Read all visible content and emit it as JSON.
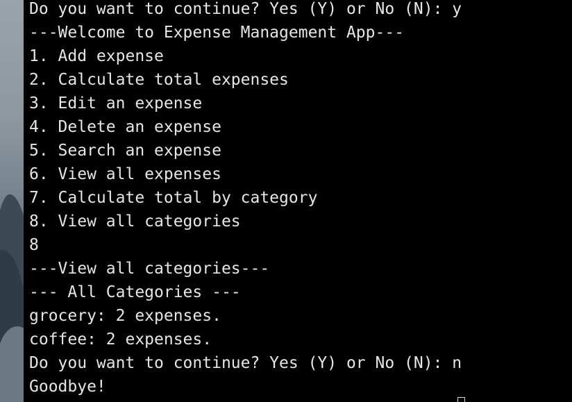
{
  "terminal": {
    "lines": [
      "Do you want to continue? Yes (Y) or No (N): y",
      "---Welcome to Expense Management App---",
      "1. Add expense",
      "2. Calculate total expenses",
      "3. Edit an expense",
      "4. Delete an expense",
      "5. Search an expense",
      "6. View all expenses",
      "7. Calculate total by category",
      "8. View all categories",
      "8",
      "---View all categories---",
      "--- All Categories ---",
      "grocery: 2 expenses.",
      "coffee: 2 expenses.",
      "Do you want to continue? Yes (Y) or No (N): n",
      "Goodbye!"
    ]
  },
  "colors": {
    "terminal_background": "#000000",
    "terminal_text": "#e6e6e6"
  }
}
